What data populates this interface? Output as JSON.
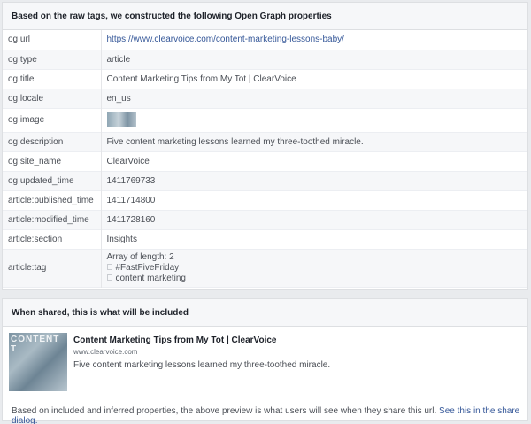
{
  "section1": {
    "header": "Based on the raw tags, we constructed the following Open Graph properties",
    "rows": [
      {
        "key": "og:url",
        "value": "https://www.clearvoice.com/content-marketing-lessons-baby/"
      },
      {
        "key": "og:type",
        "value": "article"
      },
      {
        "key": "og:title",
        "value": "Content Marketing Tips from My Tot | ClearVoice"
      },
      {
        "key": "og:locale",
        "value": "en_us"
      },
      {
        "key": "og:image",
        "value": ""
      },
      {
        "key": "og:description",
        "value": "Five content marketing lessons learned my three-toothed miracle."
      },
      {
        "key": "og:site_name",
        "value": "ClearVoice"
      },
      {
        "key": "og:updated_time",
        "value": "1411769733"
      },
      {
        "key": "article:published_time",
        "value": "1411714800"
      },
      {
        "key": "article:modified_time",
        "value": "1411728160"
      },
      {
        "key": "article:section",
        "value": "Insights"
      },
      {
        "key": "article:tag",
        "value": "Array of length: 2",
        "items": [
          "#FastFiveFriday",
          "content marketing"
        ]
      }
    ]
  },
  "section2": {
    "header": "When shared, this is what will be included",
    "preview": {
      "image_text": "CONTENT T",
      "title": "Content Marketing Tips from My Tot | ClearVoice",
      "domain": "www.clearvoice.com",
      "description": "Five content marketing lessons learned my three-toothed miracle."
    },
    "footer_text": "Based on included and inferred properties, the above preview is what users will see when they share this url.",
    "footer_link": "See this in the share dialog."
  },
  "colors": {
    "link": "#365899",
    "header_bg": "#f6f7f9",
    "border": "#dddfe2"
  }
}
